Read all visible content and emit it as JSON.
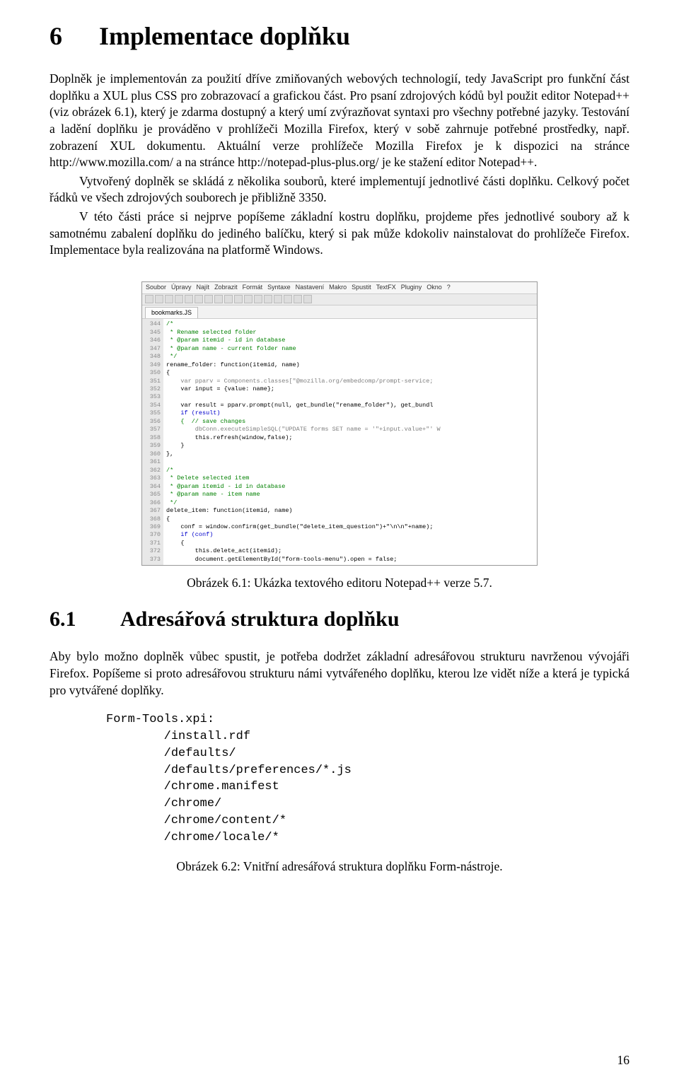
{
  "chapter": {
    "num": "6",
    "title": "Implementace doplňku"
  },
  "p1": "Doplněk je implementován za použití dříve zmiňovaných webových technologií, tedy JavaScript pro funkční část doplňku a XUL plus CSS pro zobrazovací a grafickou část. Pro psaní zdrojových kódů byl použit editor Notepad++ (viz obrázek 6.1), který je zdarma dostupný a který umí zvýrazňovat syntaxi pro všechny potřebné jazyky. Testování a ladění doplňku je prováděno v prohlížeči Mozilla Firefox, který v sobě zahrnuje potřebné prostředky, např. zobrazení XUL dokumentu. Aktuální verze prohlížeče Mozilla Firefox je k dispozici na stránce http://www.mozilla.com/ a na stránce http://notepad-plus-plus.org/ je ke stažení editor Notepad++.",
  "p2": "Vytvořený doplněk se skládá z několika souborů, které implementují jednotlivé části doplňku. Celkový počet řádků ve všech zdrojových souborech je přibližně 3350.",
  "p3": "V této části práce si nejprve popíšeme základní kostru doplňku, projdeme přes jednotlivé soubory až k samotnému zabalení doplňku do jediného balíčku, který si pak může kdokoliv nainstalovat do prohlížeče Firefox. Implementace byla realizována na platformě Windows.",
  "caption1": "Obrázek 6.1: Ukázka textového editoru Notepad++ verze 5.7.",
  "section": {
    "num": "6.1",
    "title": "Adresářová struktura doplňku"
  },
  "p4": "Aby bylo možno doplněk vůbec spustit, je potřeba dodržet základní adresářovou strukturu navrženou vývojáři Firefox. Popíšeme si proto adresářovou strukturu námi vytvářeného doplňku, kterou lze vidět níže a která je typická pro vytvářené doplňky.",
  "listing": "Form-Tools.xpi:\n        /install.rdf\n        /defaults/\n        /defaults/preferences/*.js\n        /chrome.manifest\n        /chrome/\n        /chrome/content/*\n        /chrome/locale/*",
  "caption2": "Obrázek 6.2: Vnitřní adresářová struktura doplňku Form-nástroje.",
  "pagenum": "16",
  "editor": {
    "menu": [
      "Soubor",
      "Úpravy",
      "Najít",
      "Zobrazit",
      "Formát",
      "Syntaxe",
      "Nastavení",
      "Makro",
      "Spustit",
      "TextFX",
      "Pluginy",
      "Okno",
      "?"
    ],
    "tab": "bookmarks.JS",
    "lines_start": 344,
    "lines_end": 373,
    "code": [
      {
        "t": "/*",
        "c": "c-green"
      },
      {
        "t": " * Rename selected folder",
        "c": "c-green"
      },
      {
        "t": " * @param itemid - id in database",
        "c": "c-green"
      },
      {
        "t": " * @param name - current folder name",
        "c": "c-green"
      },
      {
        "t": " */",
        "c": "c-green"
      },
      {
        "t": "rename_folder: function(itemid, name)",
        "c": "c-black"
      },
      {
        "t": "{",
        "c": "c-black"
      },
      {
        "t": "    var pparv = Components.classes[\"@mozilla.org/embedcomp/prompt-service;",
        "c": "c-gray"
      },
      {
        "t": "    var input = {value: name};",
        "c": "c-black"
      },
      {
        "t": "",
        "c": "c-black"
      },
      {
        "t": "    var result = pparv.prompt(null, get_bundle(\"rename_folder\"), get_bundl",
        "c": "c-black"
      },
      {
        "t": "    if (result)",
        "c": "c-blue"
      },
      {
        "t": "    {  // save changes",
        "c": "c-green"
      },
      {
        "t": "        dbConn.executeSimpleSQL(\"UPDATE forms SET name = '\"+input.value+\"' W",
        "c": "c-gray"
      },
      {
        "t": "        this.refresh(window,false);",
        "c": "c-black"
      },
      {
        "t": "    }",
        "c": "c-black"
      },
      {
        "t": "},",
        "c": "c-black"
      },
      {
        "t": "",
        "c": "c-black"
      },
      {
        "t": "/*",
        "c": "c-green"
      },
      {
        "t": " * Delete selected item",
        "c": "c-green"
      },
      {
        "t": " * @param itemid - id in database",
        "c": "c-green"
      },
      {
        "t": " * @param name - item name",
        "c": "c-green"
      },
      {
        "t": " */",
        "c": "c-green"
      },
      {
        "t": "delete_item: function(itemid, name)",
        "c": "c-black"
      },
      {
        "t": "{",
        "c": "c-black"
      },
      {
        "t": "    conf = window.confirm(get_bundle(\"delete_item_question\")+\"\\n\\n\"+name);",
        "c": "c-black"
      },
      {
        "t": "    if (conf)",
        "c": "c-blue"
      },
      {
        "t": "    {",
        "c": "c-black"
      },
      {
        "t": "        this.delete_act(itemid);",
        "c": "c-black"
      },
      {
        "t": "        document.getElementById(\"form-tools-menu\").open = false;",
        "c": "c-black"
      }
    ]
  }
}
